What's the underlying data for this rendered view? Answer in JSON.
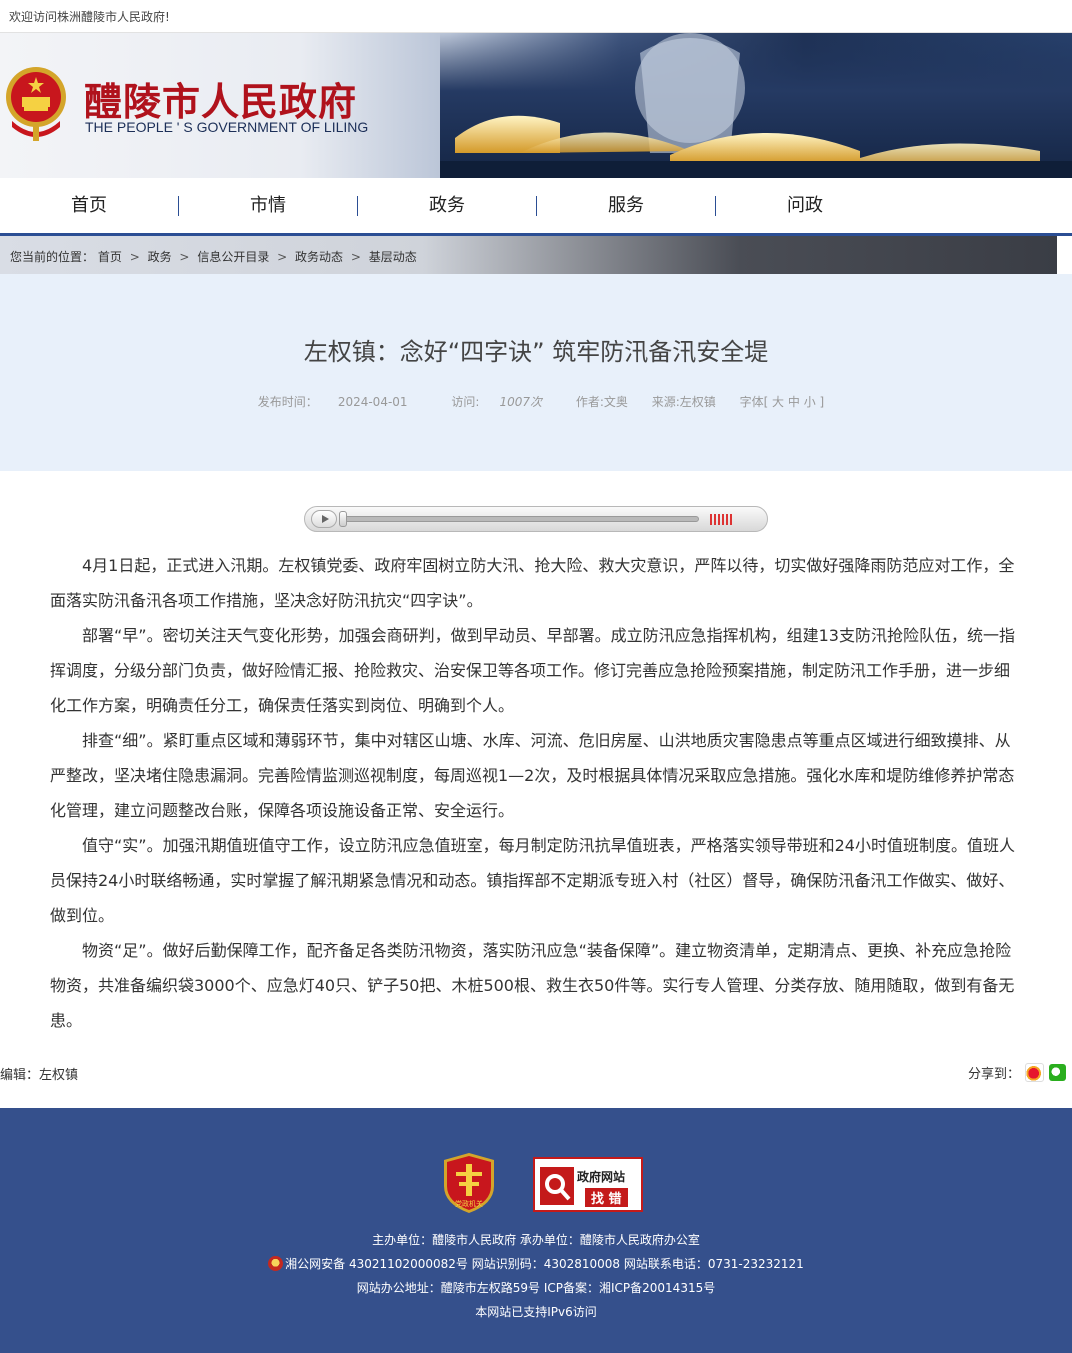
{
  "topbar": {
    "welcome": "欢迎访问株洲醴陵市人民政府!"
  },
  "header": {
    "title": "醴陵市人民政府",
    "subtitle": "THE PEOPLE ' S GOVERNMENT OF LILING"
  },
  "nav": {
    "items": [
      "首页",
      "市情",
      "政务",
      "服务",
      "问政"
    ]
  },
  "breadcrumb": {
    "label": "您当前的位置：",
    "items": [
      "首页",
      "政务",
      "信息公开目录",
      "政务动态",
      "基层动态"
    ],
    "separator": ">"
  },
  "article": {
    "title": "左权镇：念好“四字诀” 筑牢防汛备汛安全堤",
    "meta": {
      "date_label": "发布时间：",
      "date": "2024-04-01",
      "visits_label": "访问:",
      "visits": "1007次",
      "author": "作者:文奥",
      "source": "来源:左权镇",
      "font_label": "字体[ 大 中 小 ]"
    },
    "paragraphs": [
      "4月1日起，正式进入汛期。左权镇党委、政府牢固树立防大汛、抢大险、救大灾意识，严阵以待，切实做好强降雨防范应对工作，全面落实防汛备汛各项工作措施，坚决念好防汛抗灾“四字诀”。",
      "部署“早”。密切关注天气变化形势，加强会商研判，做到早动员、早部署。成立防汛应急指挥机构，组建13支防汛抢险队伍，统一指挥调度，分级分部门负责，做好险情汇报、抢险救灾、治安保卫等各项工作。修订完善应急抢险预案措施，制定防汛工作手册，进一步细化工作方案，明确责任分工，确保责任落实到岗位、明确到个人。",
      "排查“细”。紧盯重点区域和薄弱环节，集中对辖区山塘、水库、河流、危旧房屋、山洪地质灾害隐患点等重点区域进行细致摸排、从严整改，坚决堵住隐患漏洞。完善险情监测巡视制度，每周巡视1—2次，及时根据具体情况采取应急措施。强化水库和堤防维修养护常态化管理，建立问题整改台账，保障各项设施设备正常、安全运行。",
      "值守“实”。加强汛期值班值守工作，设立防汛应急值班室，每月制定防汛抗旱值班表，严格落实领导带班和24小时值班制度。值班人员保持24小时联络畅通，实时掌握了解汛期紧急情况和动态。镇指挥部不定期派专班入村（社区）督导，确保防汛备汛工作做实、做好、做到位。",
      "物资“足”。做好后勤保障工作，配齐备足各类防汛物资，落实防汛应急“装备保障”。建立物资清单，定期清点、更换、补充应急抢险物资，共准备编织袋3000个、应急灯40只、铲子50把、木桩500根、救生衣50件等。实行专人管理、分类存放、随用随取，做到有备无患。"
    ],
    "editor": "编辑：左权镇",
    "share_label": "分享到："
  },
  "audio_player": {
    "progress": 0.0,
    "volume": 0.8
  },
  "footer": {
    "party_badge_text": "党政机关",
    "error_badge": {
      "line1": "政府网站",
      "line2": "找 错"
    },
    "line1": "主办单位：醴陵市人民政府 承办单位：醴陵市人民政府办公室",
    "line2": "湘公网安备 43021102000082号 网站识别码：4302810008 网站联系电话：0731-23232121",
    "line3": "网站办公地址：醴陵市左权路59号   ICP备案：湘ICP备20014315号",
    "line4": "本网站已支持IPv6访问"
  },
  "colors": {
    "title_red": "#b0121c",
    "nav_blue": "#2b4e94",
    "footer_blue": "#35508c",
    "header_panel": "#e8f0fa"
  }
}
